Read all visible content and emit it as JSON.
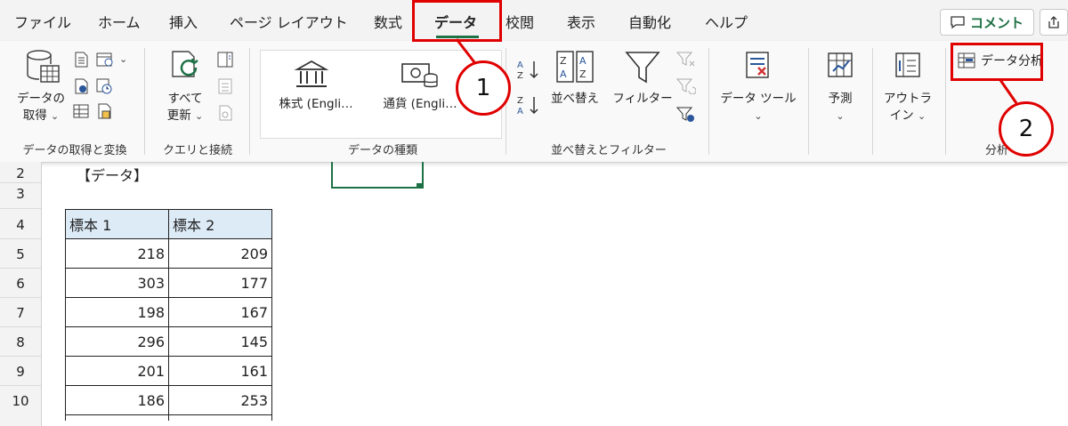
{
  "tabs": [
    "ファイル",
    "ホーム",
    "挿入",
    "ページ レイアウト",
    "数式",
    "データ",
    "校閲",
    "表示",
    "自動化",
    "ヘルプ"
  ],
  "active_tab": "データ",
  "comment_button": "コメント",
  "ribbon": {
    "get_data": {
      "line1": "データの",
      "line2": "取得"
    },
    "refresh_all": {
      "line1": "すべて",
      "line2": "更新"
    },
    "stocks": "株式 (Engli…",
    "currency": "通貨 (Engli…",
    "sort": "並べ替え",
    "filter": "フィルター",
    "data_tools": "データ ツール",
    "forecast": "予測",
    "outline": {
      "line1": "アウトラ",
      "line2": "イン"
    },
    "data_analysis": "データ分析",
    "groups": {
      "get_transform": "データの取得と変換",
      "queries": "クエリと接続",
      "data_types": "データの種類",
      "sort_filter": "並べ替えとフィルター",
      "analysis": "分析"
    }
  },
  "sheet": {
    "row_numbers": [
      "2",
      "3",
      "4",
      "5",
      "6",
      "7",
      "8",
      "9",
      "10"
    ],
    "label_cell": "【データ】",
    "table": {
      "headers": [
        "標本 1",
        "標本 2"
      ],
      "rows": [
        [
          "218",
          "209"
        ],
        [
          "303",
          "177"
        ],
        [
          "198",
          "167"
        ],
        [
          "296",
          "145"
        ],
        [
          "201",
          "161"
        ],
        [
          "186",
          "253"
        ]
      ]
    }
  },
  "callouts": [
    "1",
    "2"
  ],
  "colors": {
    "accent": "#1e7145",
    "highlight": "#e00000",
    "header_fill": "#ddebf7"
  }
}
